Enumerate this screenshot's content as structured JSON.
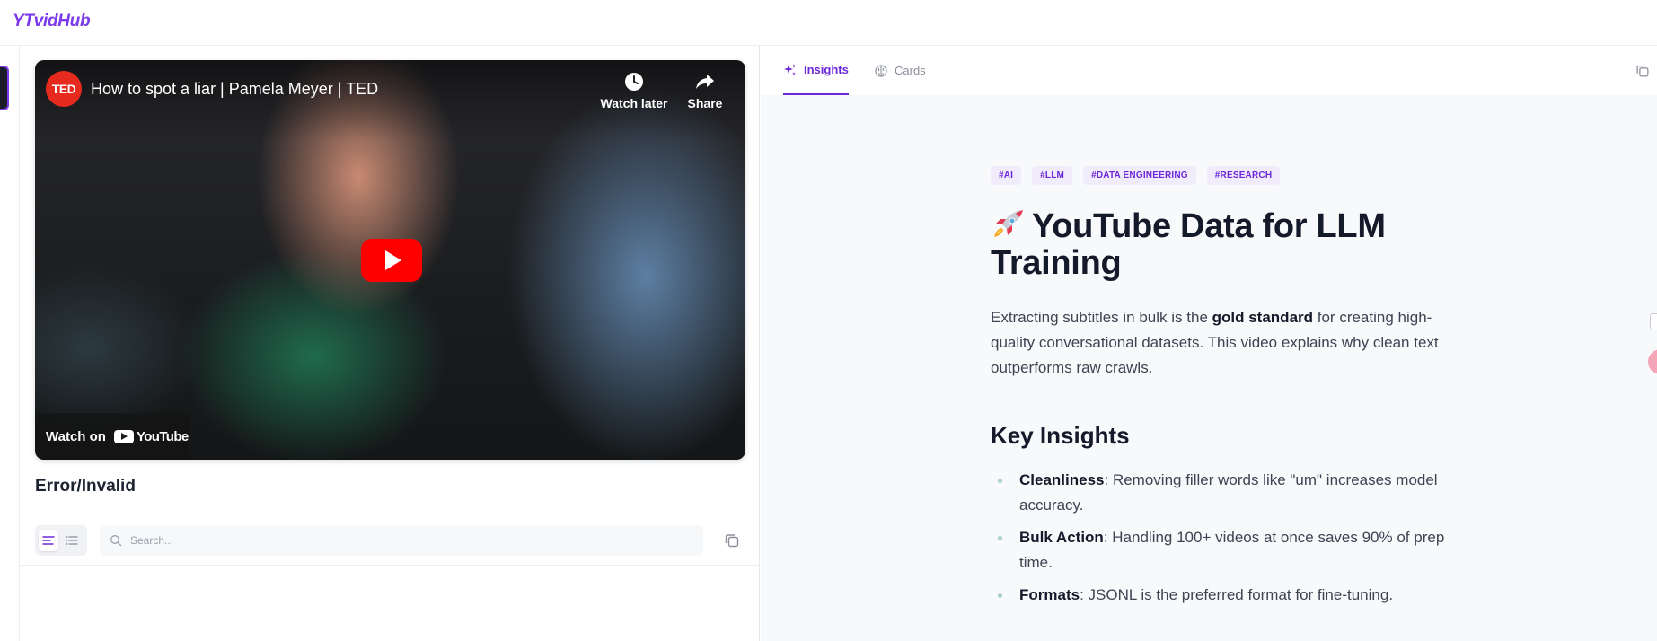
{
  "app": {
    "logo": "YTvidHub"
  },
  "video": {
    "channel_badge": "TED",
    "title": "How to spot a liar | Pamela Meyer | TED",
    "watch_later_label": "Watch later",
    "share_label": "Share",
    "watch_on_label": "Watch on",
    "youtube_word": "YouTube",
    "status": "Error/Invalid"
  },
  "transcript_toolbar": {
    "search_placeholder": "Search..."
  },
  "tabs": [
    {
      "label": "Insights",
      "icon": "sparkles-icon",
      "active": true
    },
    {
      "label": "Cards",
      "icon": "brain-icon",
      "active": false
    }
  ],
  "article": {
    "tags": [
      "#AI",
      "#LLM",
      "#DATA ENGINEERING",
      "#RESEARCH"
    ],
    "title_emoji": "rocket",
    "title": "YouTube Data for LLM Training",
    "lead_before": "Extracting subtitles in bulk is the ",
    "lead_bold": "gold standard",
    "lead_after": " for creating high-quality conversational datasets. This video explains why clean text outperforms raw crawls.",
    "section_heading": "Key Insights",
    "insights": [
      {
        "term": "Cleanliness",
        "text": ": Removing filler words like \"um\" increases model accuracy."
      },
      {
        "term": "Bulk Action",
        "text": ": Handling 100+ videos at once saves 90% of prep time."
      },
      {
        "term": "Formats",
        "text": ": JSONL is the preferred format for fine-tuning."
      }
    ]
  },
  "colors": {
    "accent": "#6d28d9",
    "logo": "#7c3aed",
    "youtube_red": "#ff0000",
    "ted_red": "#e62b1e"
  }
}
